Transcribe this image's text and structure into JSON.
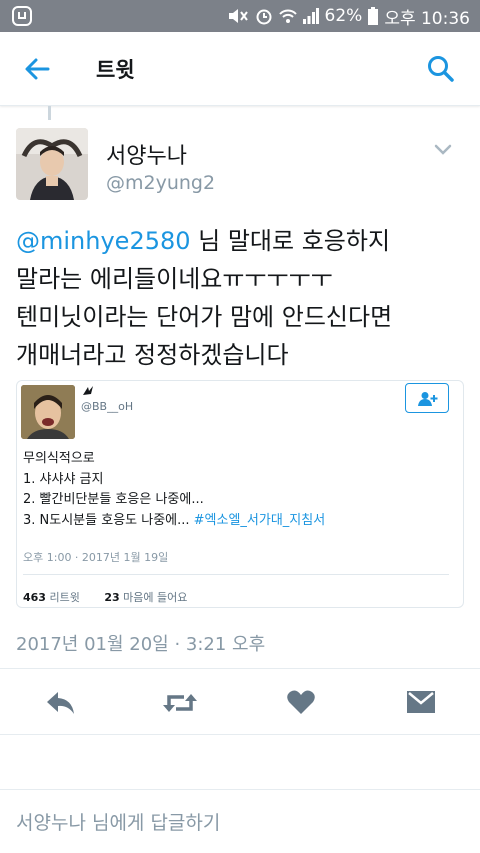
{
  "status_bar": {
    "battery": "62%",
    "time": "오후 10:36",
    "icons": [
      "app-notification-icon",
      "mute-icon",
      "alarm-icon",
      "wifi-icon",
      "signal-icon",
      "battery-icon"
    ]
  },
  "app_bar": {
    "title": "트윗",
    "back_icon": "arrow-left-icon",
    "search_icon": "search-icon",
    "accent_color": "#1b95e0"
  },
  "tweet": {
    "display_name": "서양누나",
    "handle": "@m2yung2",
    "mention": "@minhye2580",
    "text_lines": [
      " 님 말대로 호응하지",
      "말라는 에리들이네요ㅠㅜㅜㅜㅜ",
      "텐미닛이라는 단어가 맘에 안드신다면",
      "개매너라고 정정하겠습니다"
    ],
    "timestamp": "2017년 01월 20일 · 3:21 오후"
  },
  "quoted_tweet": {
    "handle": "@BB__oH",
    "lines": [
      "무의식적으로",
      "1. 샤샤샤 금지",
      "2. 빨간비단분들 호응은 나중에...",
      "3. N도시분들 호응도 나중에... "
    ],
    "hashtag": "#엑소엘_서가대_지침서",
    "time": "오후 1:00 · 2017년 1월 19일",
    "retweet_count": "463",
    "retweet_label": "리트윗",
    "like_count": "23",
    "like_label": "마음에 들어요"
  },
  "actions": {
    "icons": [
      "reply-icon",
      "retweet-icon",
      "like-icon",
      "direct-message-icon"
    ]
  },
  "reply": {
    "placeholder": "서양누나 님에게 답글하기"
  }
}
